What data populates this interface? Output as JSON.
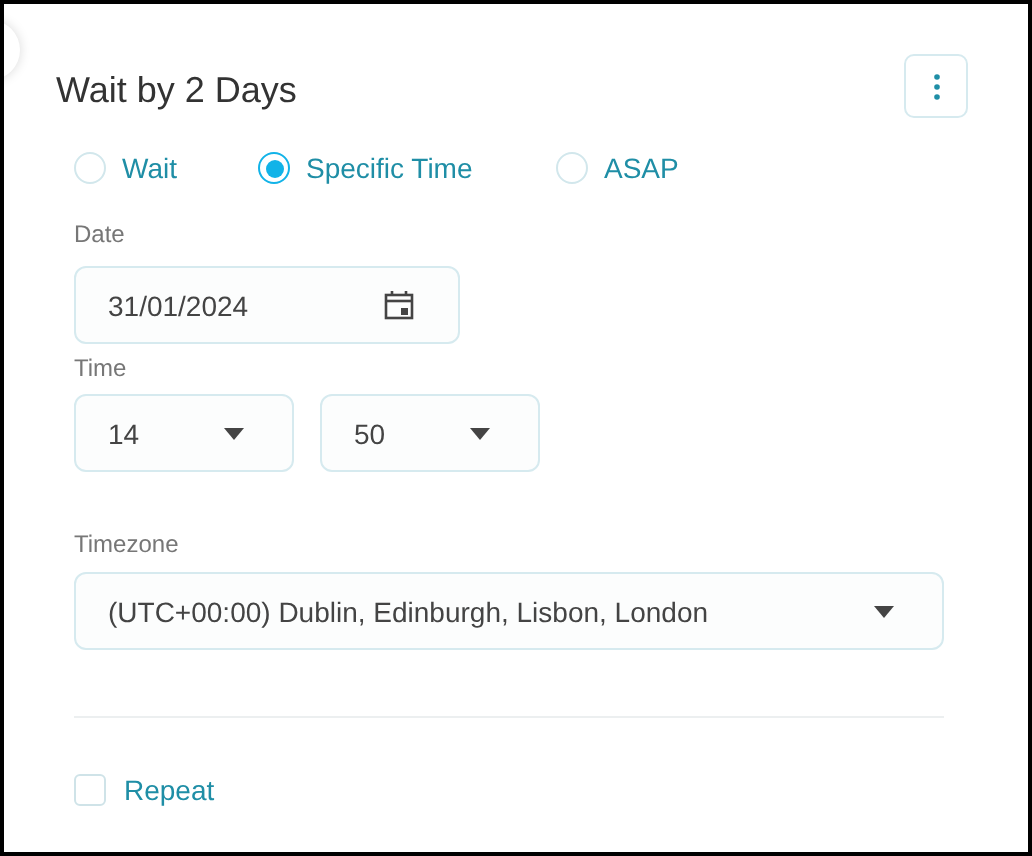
{
  "title": "Wait by 2 Days",
  "mode_options": [
    {
      "label": "Wait",
      "selected": false
    },
    {
      "label": "Specific Time",
      "selected": true
    },
    {
      "label": "ASAP",
      "selected": false
    }
  ],
  "date": {
    "label": "Date",
    "value": "31/01/2024"
  },
  "time": {
    "label": "Time",
    "hour": "14",
    "minute": "50"
  },
  "timezone": {
    "label": "Timezone",
    "value": "(UTC+00:00) Dublin, Edinburgh, Lisbon, London"
  },
  "repeat": {
    "label": "Repeat",
    "checked": false
  }
}
